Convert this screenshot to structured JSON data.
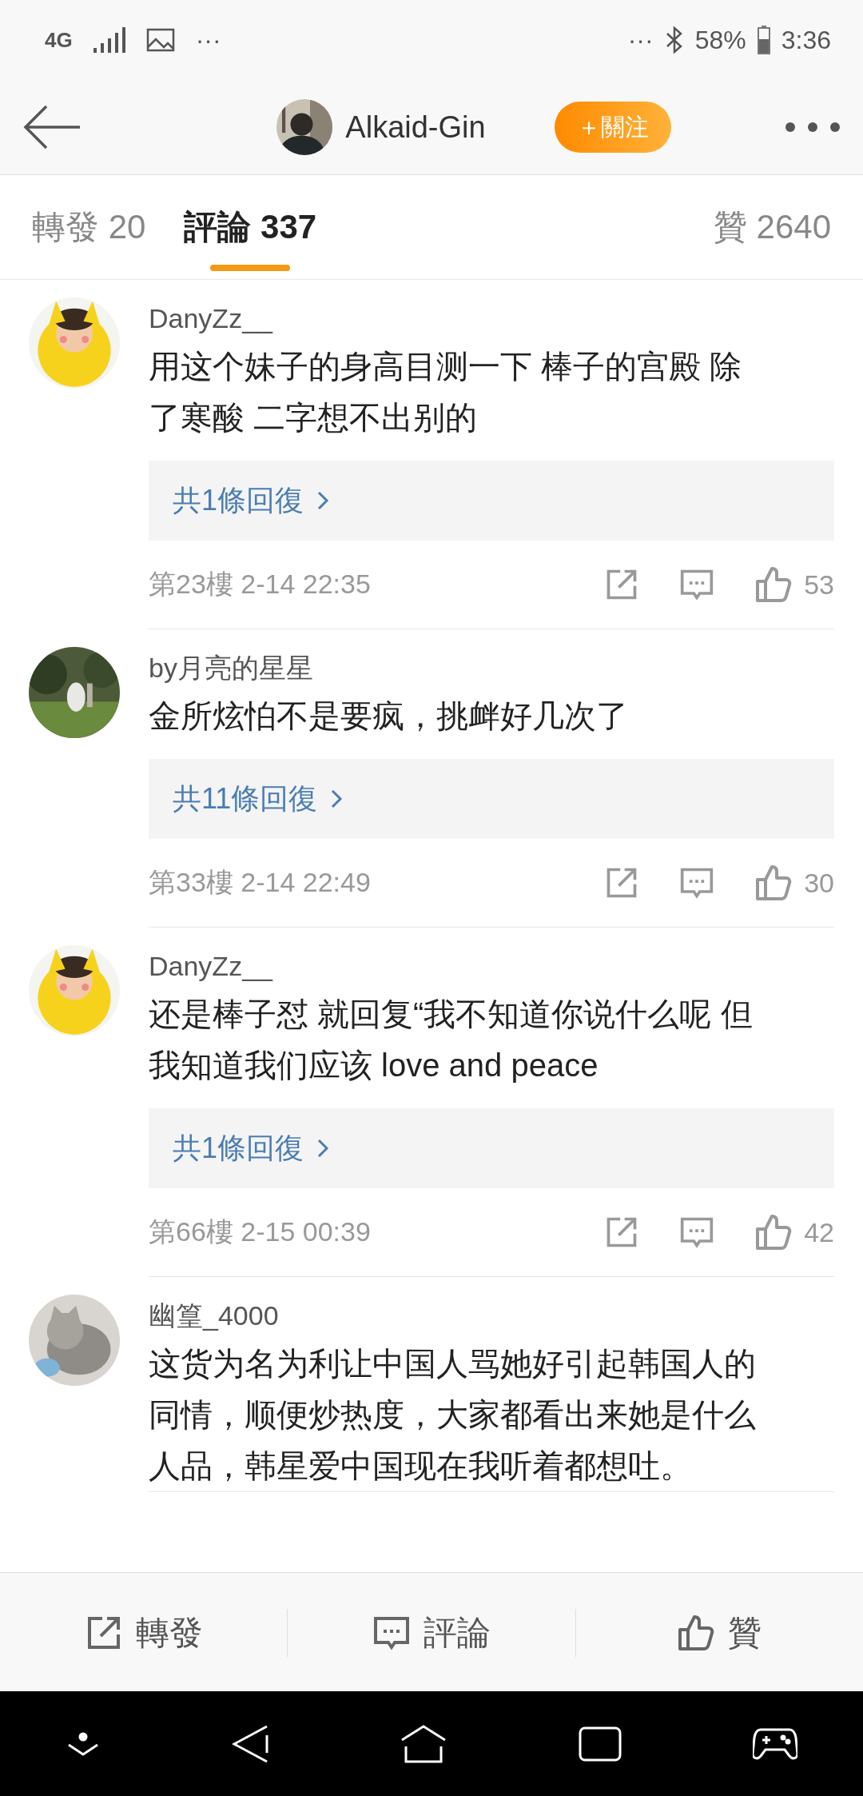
{
  "status_bar": {
    "network": "4G",
    "dots_left": "···",
    "dots_right": "···",
    "battery": "58%",
    "time": "3:36"
  },
  "header": {
    "username": "Alkaid-Gin",
    "follow_button": "＋關注"
  },
  "tabs": [
    {
      "label": "轉發",
      "count": "20",
      "selected": false
    },
    {
      "label": "評論",
      "count": "337",
      "selected": true
    },
    {
      "label": "贊",
      "count": "2640",
      "selected": false
    }
  ],
  "comments": [
    {
      "user": "DanyZz__",
      "text": "用这个妹子的身高目测一下 棒子的宫殿 除了寒酸 二字想不出别的",
      "replies": "共1條回復",
      "floor": "第23樓",
      "time": "2-14 22:35",
      "likes": "53"
    },
    {
      "user": "by月亮的星星",
      "text": "金所炫怕不是要疯，挑衅好几次了",
      "replies": "共11條回復",
      "floor": "第33樓",
      "time": "2-14 22:49",
      "likes": "30"
    },
    {
      "user": "DanyZz__",
      "text": "还是棒子怼 就回复“我不知道你说什么呢 但我知道我们应该 love and peace",
      "replies": "共1條回復",
      "floor": "第66樓",
      "time": "2-15 00:39",
      "likes": "42"
    },
    {
      "user": "幽篁_4000",
      "text": "这货为名为利让中国人骂她好引起韩国人的同情，顺便炒热度，大家都看出来她是什么人品，韩星爱中国现在我听着都想吐。"
    }
  ],
  "bottom_bar": [
    {
      "kind": "repost",
      "label": "轉發"
    },
    {
      "kind": "comment",
      "label": "評論"
    },
    {
      "kind": "like",
      "label": "贊"
    }
  ]
}
